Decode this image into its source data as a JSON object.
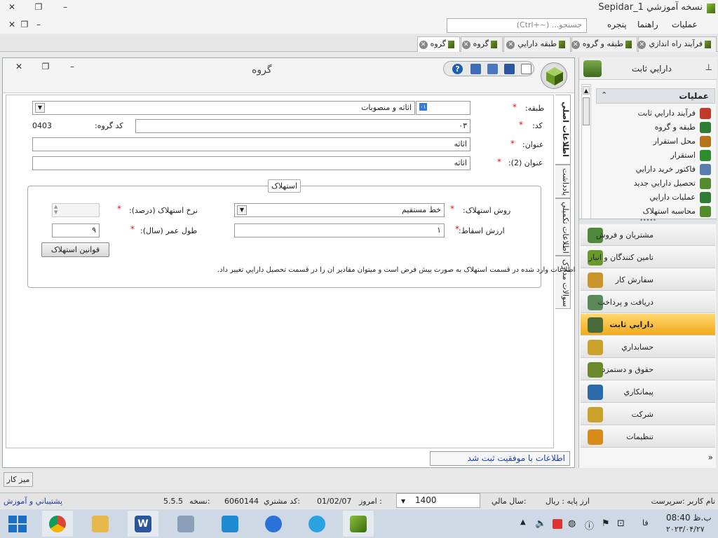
{
  "window": {
    "title": "Sepidar_1 نسخه آموزشي",
    "minimize": "–",
    "restore": "❐",
    "close": "✕"
  },
  "menu": {
    "items": [
      "عمليات",
      "راهنما",
      "پنجره"
    ],
    "search_placeholder": "جستجو... (~+Ctrl)"
  },
  "tabs": [
    {
      "label": "فرآيند راه اندازي"
    },
    {
      "label": "طبقه و گروه"
    },
    {
      "label": "طبقه دارايي"
    },
    {
      "label": "گروه"
    },
    {
      "label": "گروه"
    }
  ],
  "form": {
    "title": "گروه",
    "vtabs": [
      "اطلاعات اصلي",
      "يادداشت",
      "اطلاعات تکميلي",
      "سوالات مدارک"
    ],
    "class_label": "طبقه:",
    "class_code": "۰۱",
    "class_value": "اثاثه و منصوبات",
    "code_label": "کد:",
    "code_value": "۰۳",
    "group_code_label": "کد گروه:",
    "group_code_value": "0403",
    "title_label": "عنوان:",
    "title_value": "اثاثه",
    "title2_label": "عنوان (2):",
    "title2_value": "اثاثه",
    "depreciation_legend": "استهلاک",
    "dep_method_label": "روش استهلاک:",
    "dep_method_value": "خط مستقيم",
    "dep_rate_label": "نرخ استهلاک (درصد):",
    "dep_rate_value": "",
    "salvage_label": "ارزش اسقاط:",
    "salvage_value": "۱",
    "life_label": "طول عمر (سال):",
    "life_value": "۹",
    "rules_button": "قوانين استهلاک",
    "note": "اطلاعات وارد شده در قسمت استهلاک به صورت پيش فرض است  و ميتوان مقادير ان را در قسمت تحصيل دارايي تغيير داد.",
    "status": "اطلاعات با موفقيت ثبت شد"
  },
  "sidepanel": {
    "title": "دارايي ثابت",
    "section": "عمليات",
    "ops": [
      {
        "label": "فرآيند دارايي ثابت",
        "color": "#c0392b"
      },
      {
        "label": "طبقه و گروه",
        "color": "#2e7d32"
      },
      {
        "label": "محل استقرار",
        "color": "#b8741a"
      },
      {
        "label": "استقرار",
        "color": "#2e8b2e"
      },
      {
        "label": "فاکتور خريد دارايي",
        "color": "#5a7db0"
      },
      {
        "label": "تحصيل دارايي جديد",
        "color": "#558b2f"
      },
      {
        "label": "عمليات دارايي",
        "color": "#2e7d32"
      },
      {
        "label": "محاسبه استهلاک",
        "color": "#558b2f"
      }
    ],
    "modules": [
      {
        "label": "مشتريان و فروش",
        "color": "#4e8a3a"
      },
      {
        "label": "تامين کنندگان و انبار",
        "color": "#6a9a2a"
      },
      {
        "label": "سفارش کار",
        "color": "#c9952a"
      },
      {
        "label": "دريافت و پرداخت",
        "color": "#5a8a5a"
      },
      {
        "label": "دارايي ثابت",
        "color": "#4a6a3a"
      },
      {
        "label": "حسابداري",
        "color": "#caa22a"
      },
      {
        "label": "حقوق و دستمزد",
        "color": "#6a8a2a"
      },
      {
        "label": "پيمانکاري",
        "color": "#2a6aa8"
      },
      {
        "label": "شرکت",
        "color": "#c9a22a"
      },
      {
        "label": "تنظيمات",
        "color": "#d88a1a"
      }
    ]
  },
  "desktop_button": "ميز کار",
  "statusbar": {
    "user": "نام کاربر :سرپرست",
    "currency": "ارز پايه :  ريال",
    "fiscal_year_label": "سال مالي:",
    "fiscal_year": "1400",
    "today_label": "امروز :",
    "today": "01/02/07",
    "customer_label": "کد مشتري:",
    "customer": "6060144",
    "version_label": "نسخه:",
    "version": "5.5.5",
    "support": "پشتيباني و آموزش"
  },
  "taskbar": {
    "time": "ب.ظ 08:40",
    "date": "۲۰۲۳/۰۴/۲۷",
    "lang": "فا"
  }
}
